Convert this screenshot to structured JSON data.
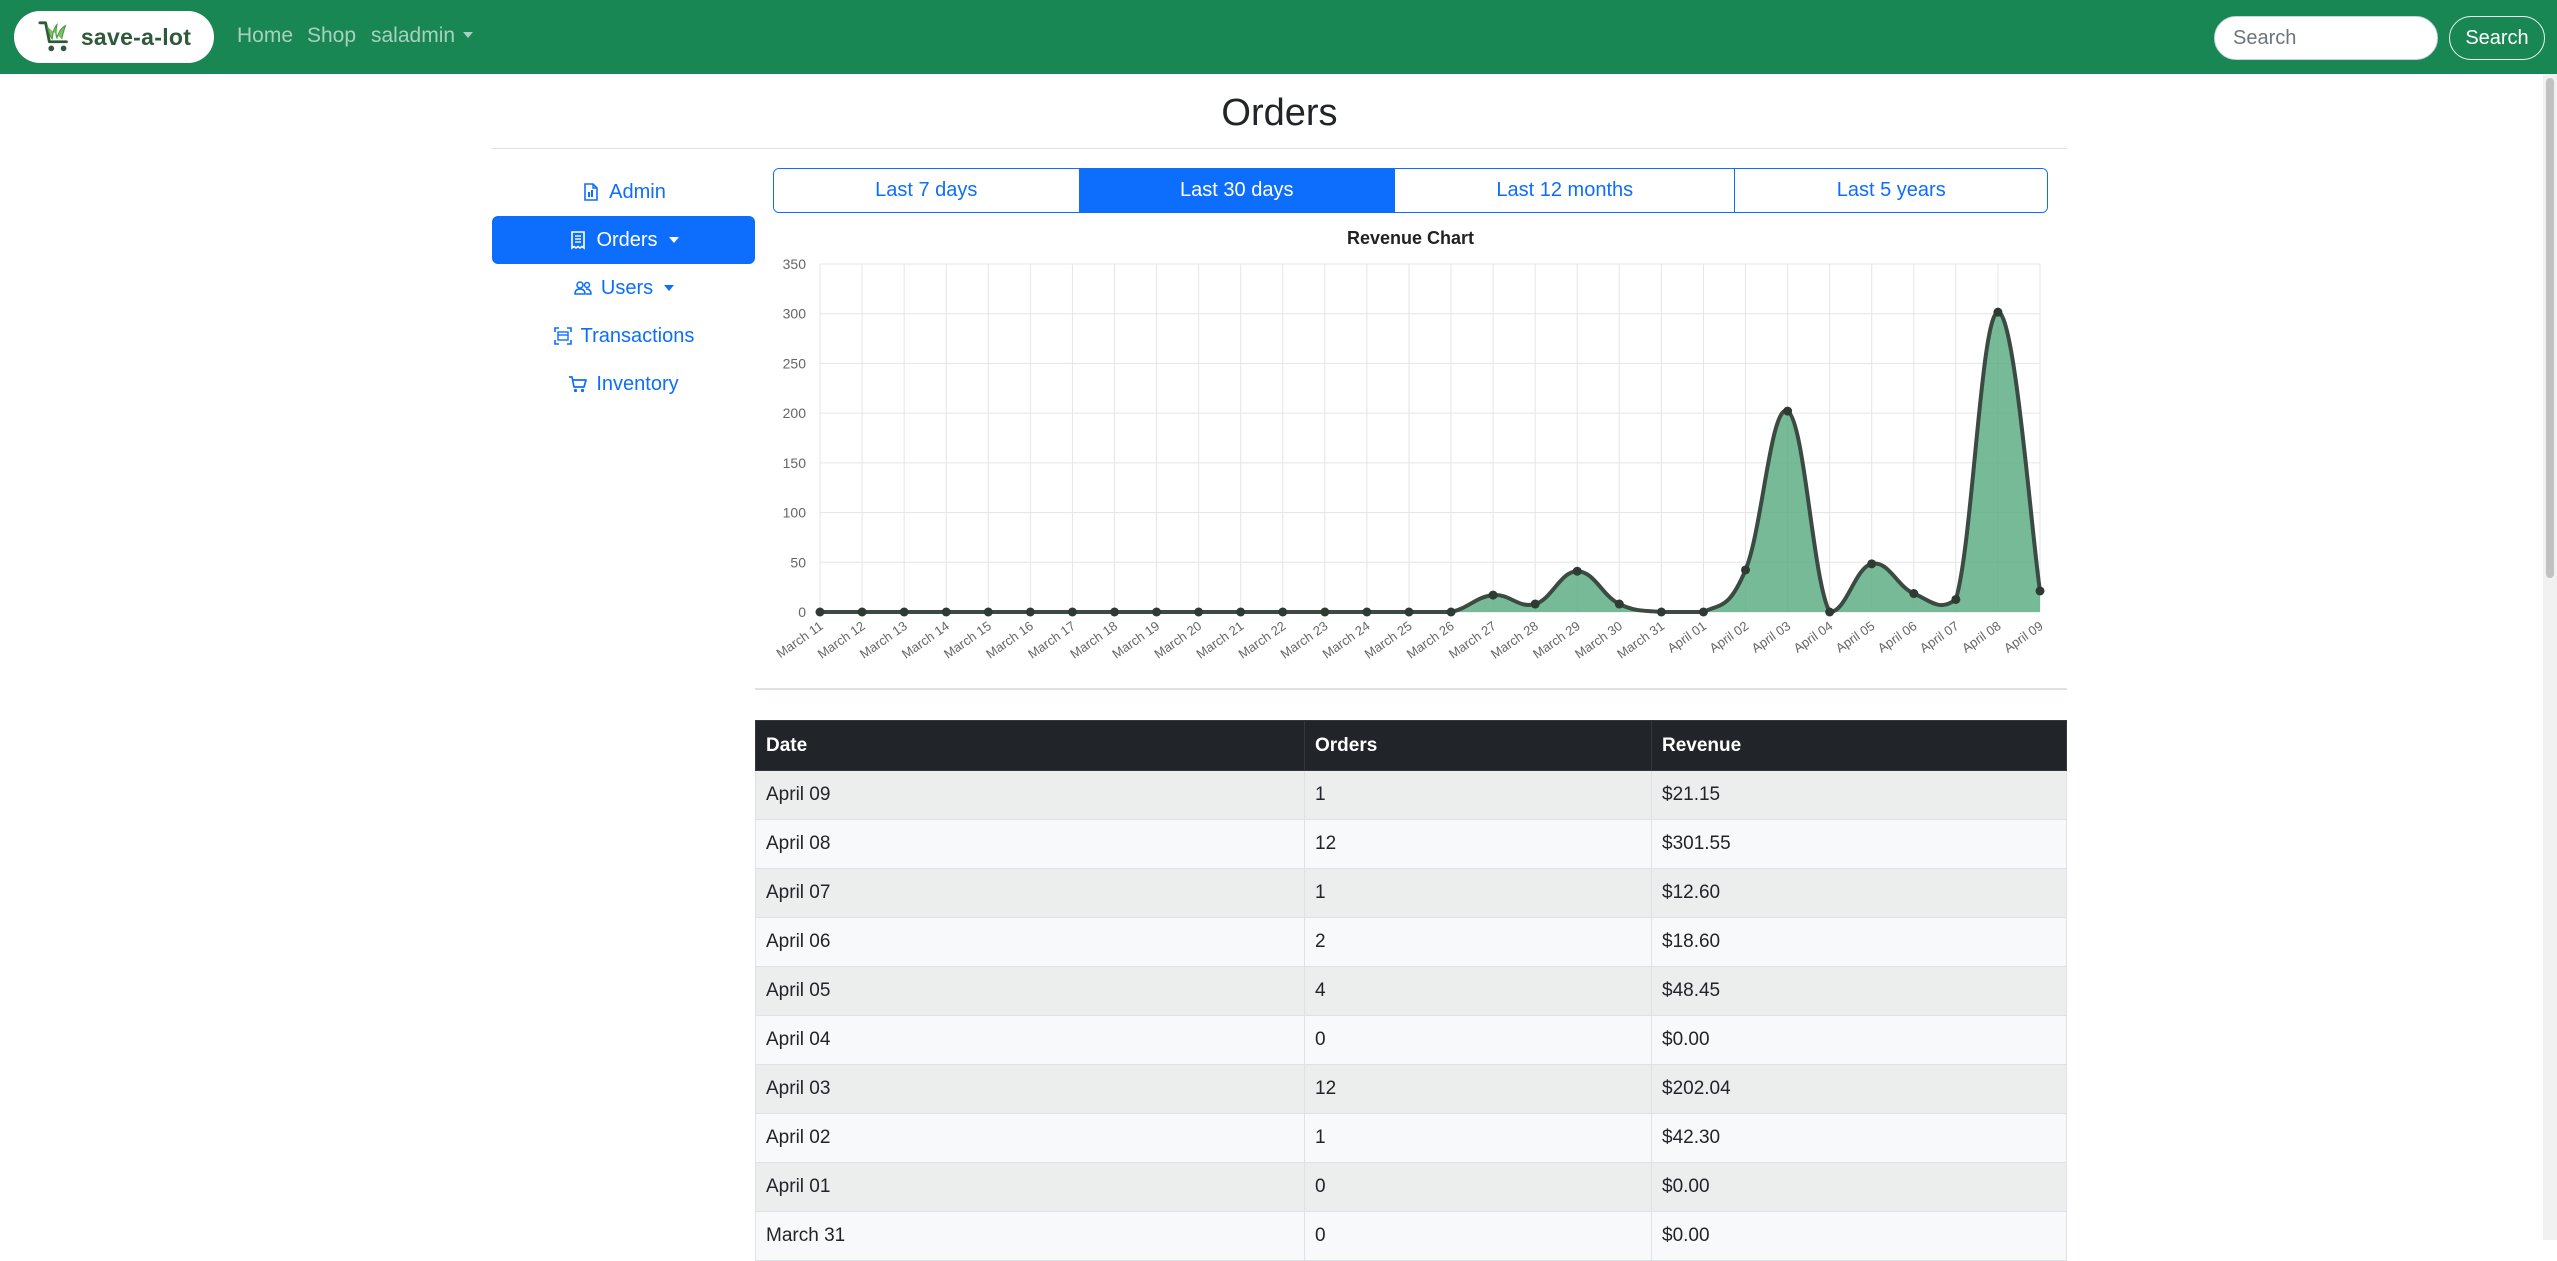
{
  "navbar": {
    "brand": "save-a-lot",
    "links": {
      "home": "Home",
      "shop": "Shop",
      "user": "saladmin"
    },
    "search": {
      "placeholder": "Search",
      "button": "Search"
    }
  },
  "page": {
    "title": "Orders"
  },
  "sidebar": {
    "items": [
      {
        "label": "Admin",
        "icon": "document-icon",
        "active": false,
        "dropdown": false
      },
      {
        "label": "Orders",
        "icon": "receipt-icon",
        "active": true,
        "dropdown": true
      },
      {
        "label": "Users",
        "icon": "people-icon",
        "active": false,
        "dropdown": true
      },
      {
        "label": "Transactions",
        "icon": "scan-icon",
        "active": false,
        "dropdown": false
      },
      {
        "label": "Inventory",
        "icon": "cart-icon",
        "active": false,
        "dropdown": false
      }
    ]
  },
  "tabs": [
    {
      "label": "Last 7 days",
      "active": false
    },
    {
      "label": "Last 30 days",
      "active": true
    },
    {
      "label": "Last 12 months",
      "active": false
    },
    {
      "label": "Last 5 years",
      "active": false
    }
  ],
  "chart_data": {
    "type": "area",
    "title": "Revenue Chart",
    "xlabel": "",
    "ylabel": "",
    "ylim": [
      0,
      350
    ],
    "yticks": [
      0,
      50,
      100,
      150,
      200,
      250,
      300,
      350
    ],
    "grid": true,
    "legend": "none",
    "categories": [
      "March 11",
      "March 12",
      "March 13",
      "March 14",
      "March 15",
      "March 16",
      "March 17",
      "March 18",
      "March 19",
      "March 20",
      "March 21",
      "March 22",
      "March 23",
      "March 24",
      "March 25",
      "March 26",
      "March 27",
      "March 28",
      "March 29",
      "March 30",
      "March 31",
      "April 01",
      "April 02",
      "April 03",
      "April 04",
      "April 05",
      "April 06",
      "April 07",
      "April 08",
      "April 09"
    ],
    "series": [
      {
        "values": [
          0,
          0,
          0,
          0,
          0,
          0,
          0,
          0,
          0,
          0,
          0,
          0,
          0,
          0,
          0,
          0,
          17,
          8,
          41,
          8,
          0,
          0,
          42.3,
          202.04,
          0,
          48.45,
          18.6,
          12.6,
          301.55,
          21.15
        ]
      }
    ],
    "colors": {
      "fill": "#5fae86",
      "line": "#3b4a42",
      "point": "#2e3b33",
      "grid": "#e5e5e5"
    }
  },
  "table": {
    "headers": [
      "Date",
      "Orders",
      "Revenue"
    ],
    "rows": [
      [
        "April 09",
        "1",
        "$21.15"
      ],
      [
        "April 08",
        "12",
        "$301.55"
      ],
      [
        "April 07",
        "1",
        "$12.60"
      ],
      [
        "April 06",
        "2",
        "$18.60"
      ],
      [
        "April 05",
        "4",
        "$48.45"
      ],
      [
        "April 04",
        "0",
        "$0.00"
      ],
      [
        "April 03",
        "12",
        "$202.04"
      ],
      [
        "April 02",
        "1",
        "$42.30"
      ],
      [
        "April 01",
        "0",
        "$0.00"
      ],
      [
        "March 31",
        "0",
        "$0.00"
      ]
    ]
  },
  "colors": {
    "navbar": "#198754",
    "primary": "#0d6efd",
    "table_header": "#212529"
  }
}
